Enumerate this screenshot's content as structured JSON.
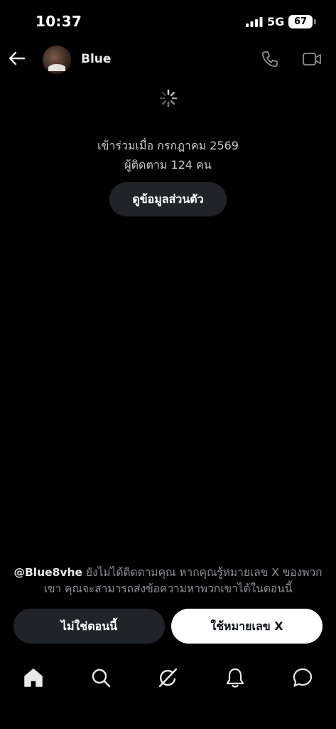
{
  "status_bar": {
    "time": "10:37",
    "network": "5G",
    "battery": "67"
  },
  "header": {
    "name": "Blue"
  },
  "conversation": {
    "joined": "เข้าร่วมเมื่อ กรกฎาคม 2569",
    "followers": "ผู้ติดตาม 124 คน",
    "view_profile": "ดูข้อมูลส่วนตัว"
  },
  "notice": {
    "handle": "@Blue8vhe",
    "text": " ยังไม่ได้ติดตามคุณ หากคุณรู้หมายเลข X ของพวกเขา คุณจะสามารถส่งข้อความหาพวกเขาได้ในตอนนี้"
  },
  "actions": {
    "not_now": "ไม่ใช่ตอนนี้",
    "use_x_number": "ใช้หมายเลข X"
  },
  "icons": {
    "back": "arrow-left-icon",
    "call": "phone-icon",
    "video": "video-camera-icon",
    "home": "home-icon",
    "search": "search-icon",
    "grok": "grok-icon",
    "notifications": "bell-icon",
    "messages": "message-icon",
    "loading": "spinner-icon"
  }
}
